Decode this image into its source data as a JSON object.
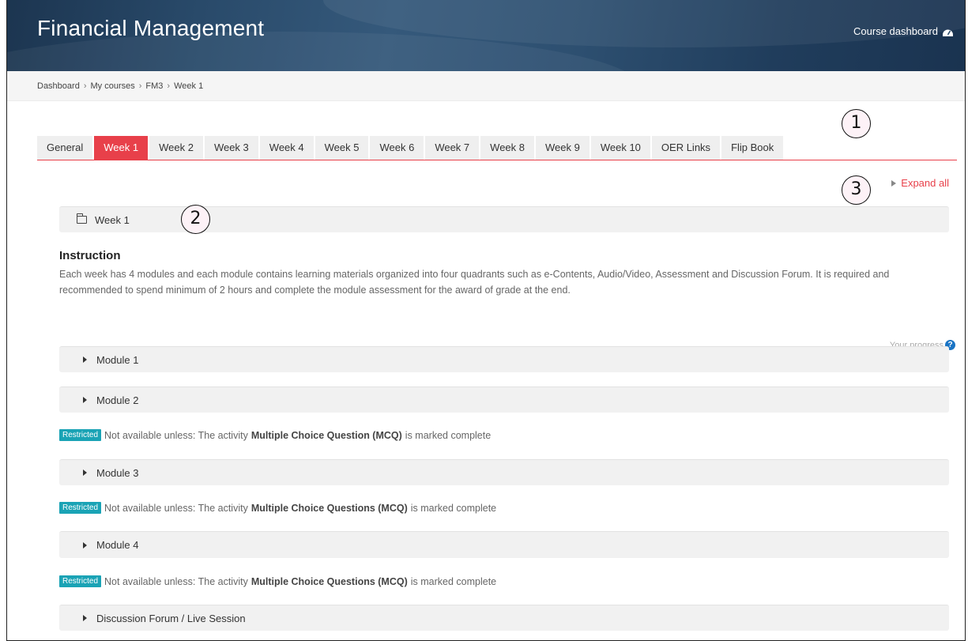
{
  "header": {
    "title": "Financial Management",
    "dashboard_link": "Course dashboard"
  },
  "breadcrumb": [
    "Dashboard",
    "My courses",
    "FM3",
    "Week 1"
  ],
  "breadcrumb_sep": "›",
  "tabs": [
    "General",
    "Week 1",
    "Week 2",
    "Week 3",
    "Week 4",
    "Week 5",
    "Week 6",
    "Week 7",
    "Week 8",
    "Week 9",
    "Week 10",
    "OER Links",
    "Flip Book"
  ],
  "active_tab": "Week 1",
  "callouts": [
    "1",
    "2",
    "3"
  ],
  "expand_all": "Expand all",
  "section": {
    "title": "Week 1"
  },
  "instruction": {
    "title": "Instruction",
    "body": "Each week has 4 modules and each module contains learning materials organized into four quadrants such as e-Contents, Audio/Video, Assessment and Discussion Forum. It is required and recommended to spend minimum of 2 hours and complete the module assessment for the award of grade at the end."
  },
  "progress_label": "Your progress",
  "progress_help": "?",
  "modules": [
    "Module 1",
    "Module 2",
    "Module 3",
    "Module 4",
    "Discussion Forum / Live Session"
  ],
  "restrictions": [
    {
      "tag": "Restricted",
      "prefix": "Not available unless: The activity",
      "activity": "Multiple Choice Question (MCQ)",
      "suffix": "is marked complete"
    },
    {
      "tag": "Restricted",
      "prefix": "Not available unless: The activity",
      "activity": "Multiple Choice Questions (MCQ)",
      "suffix": "is marked complete"
    },
    {
      "tag": "Restricted",
      "prefix": "Not available unless: The activity",
      "activity": "Multiple Choice Questions (MCQ)",
      "suffix": "is marked complete"
    }
  ],
  "colors": {
    "accent": "#e8404a",
    "restricted": "#1aa3b5",
    "banner": "#294a6a"
  }
}
